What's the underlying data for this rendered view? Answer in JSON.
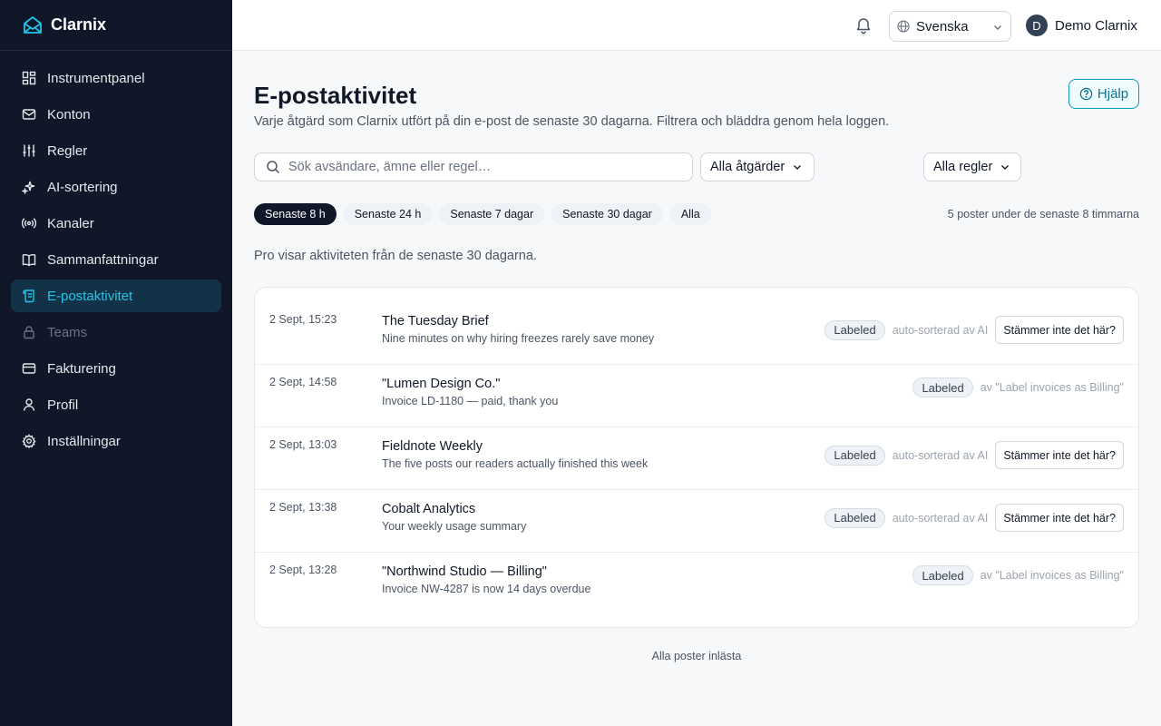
{
  "brand": {
    "name": "Clarnix",
    "icon": "mail-envelope-icon"
  },
  "sidebar": {
    "items": [
      {
        "label": "Instrumentpanel",
        "icon": "dashboard-icon"
      },
      {
        "label": "Konton",
        "icon": "mail-icon"
      },
      {
        "label": "Regler",
        "icon": "sliders-icon"
      },
      {
        "label": "AI-sortering",
        "icon": "sparkles-icon"
      },
      {
        "label": "Kanaler",
        "icon": "broadcast-icon"
      },
      {
        "label": "Sammanfattningar",
        "icon": "book-icon"
      },
      {
        "label": "E-postaktivitet",
        "icon": "scroll-icon",
        "active": true
      },
      {
        "label": "Teams",
        "icon": "lock-icon",
        "disabled": true
      },
      {
        "label": "Fakturering",
        "icon": "credit-card-icon"
      },
      {
        "label": "Profil",
        "icon": "user-icon"
      },
      {
        "label": "Inställningar",
        "icon": "gear-icon"
      }
    ]
  },
  "topbar": {
    "language": "Svenska",
    "user_initial": "D",
    "user_name": "Demo Clarnix"
  },
  "page": {
    "title": "E-postaktivitet",
    "subtitle": "Varje åtgärd som Clarnix utfört på din e-post de senaste 30 dagarna. Filtrera och bläddra genom hela loggen.",
    "help_label": "Hjälp"
  },
  "filters": {
    "search_placeholder": "Sök avsändare, ämne eller regel…",
    "actions_select": "Alla åtgärder",
    "rules_select": "Alla regler",
    "time_chips": [
      "Senaste 8 h",
      "Senaste 24 h",
      "Senaste 7 dagar",
      "Senaste 30 dagar",
      "Alla"
    ],
    "active_chip": 0,
    "count_text": "5 poster under de senaste 8 timmarna"
  },
  "pro_note": "Pro visar aktiviteten från de senaste 30 dagarna.",
  "activity": [
    {
      "time": "2 Sept, 15:23",
      "sender": "The Tuesday Brief",
      "subject": "Nine minutes on why hiring freezes rarely save money",
      "badge": "Labeled",
      "source": "auto-sorterad av AI",
      "action": "Stämmer inte det här?"
    },
    {
      "time": "2 Sept, 14:58",
      "sender": "\"Lumen Design Co.\"",
      "subject": "Invoice LD-1180 — paid, thank you",
      "badge": "Labeled",
      "source": "av \"Label invoices as Billing\""
    },
    {
      "time": "2 Sept, 13:03",
      "sender": "Fieldnote Weekly",
      "subject": "The five posts our readers actually finished this week",
      "badge": "Labeled",
      "source": "auto-sorterad av AI",
      "action": "Stämmer inte det här?"
    },
    {
      "time": "2 Sept, 13:38",
      "sender": "Cobalt Analytics",
      "subject": "Your weekly usage summary",
      "badge": "Labeled",
      "source": "auto-sorterad av AI",
      "action": "Stämmer inte det här?"
    },
    {
      "time": "2 Sept, 13:28",
      "sender": "\"Northwind Studio — Billing\"",
      "subject": "Invoice NW-4287 is now 14 days overdue",
      "badge": "Labeled",
      "source": "av \"Label invoices as Billing\""
    }
  ],
  "footer_note": "Alla poster inlästa"
}
